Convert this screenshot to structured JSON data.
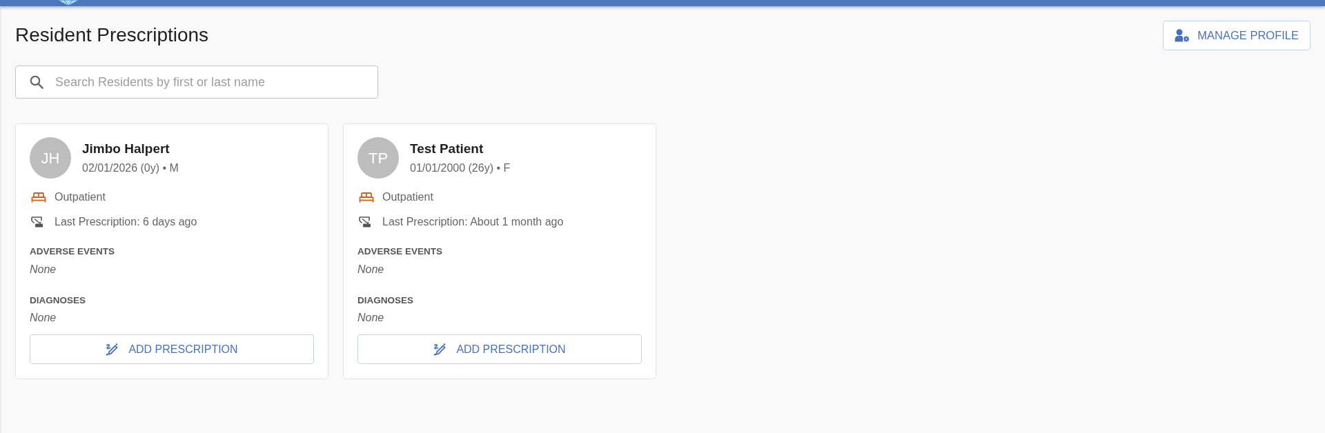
{
  "page": {
    "title": "Resident Prescriptions",
    "manage_profile_button": "MANAGE PROFILE"
  },
  "search": {
    "placeholder": "Search Residents by first or last name"
  },
  "residents": [
    {
      "initials": "JH",
      "name": "Jimbo Halpert",
      "details": "02/01/2026 (0y) • M",
      "care_setting": "Outpatient",
      "last_prescription": "Last Prescription: 6 days ago",
      "sections": [
        {
          "heading": "ADVERSE EVENTS",
          "value": "None"
        },
        {
          "heading": "DIAGNOSES",
          "value": "None"
        }
      ],
      "action_button": "ADD PRESCRIPTION"
    },
    {
      "initials": "TP",
      "name": "Test Patient",
      "details": "01/01/2000 (26y) • F",
      "care_setting": "Outpatient",
      "last_prescription": "Last Prescription: About 1 month ago",
      "sections": [
        {
          "heading": "ADVERSE EVENTS",
          "value": "None"
        },
        {
          "heading": "DIAGNOSES",
          "value": "None"
        }
      ],
      "action_button": "ADD PRESCRIPTION"
    }
  ]
}
